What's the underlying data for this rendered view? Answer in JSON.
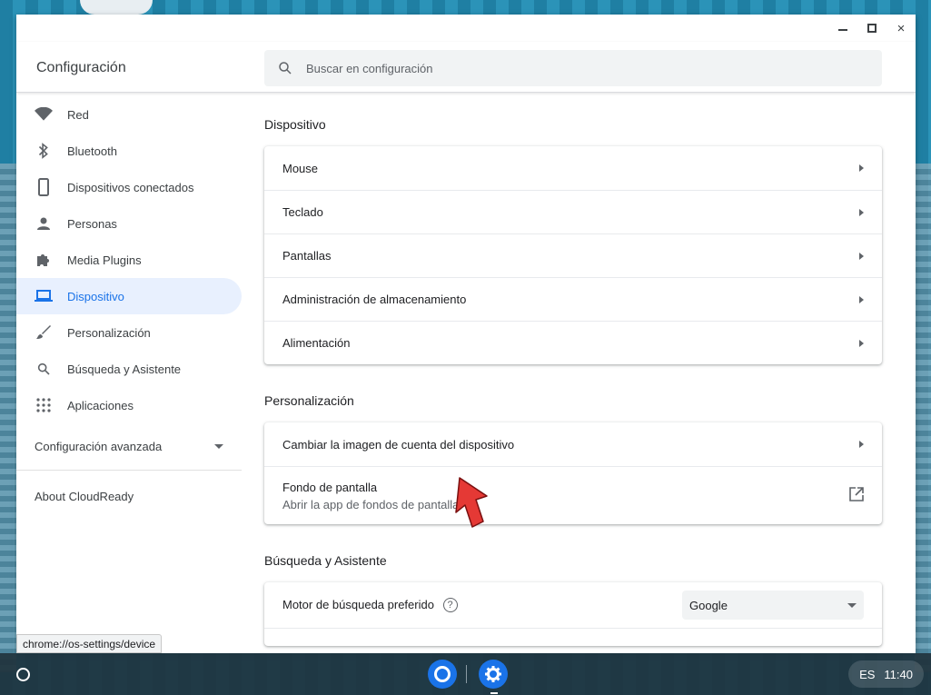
{
  "window": {
    "title": "Configuración",
    "controls": {
      "minimize": "minimize-icon",
      "maximize": "maximize-icon",
      "close": "×"
    }
  },
  "search": {
    "placeholder": "Buscar en configuración",
    "icon": "search-icon"
  },
  "sidebar": {
    "items": [
      {
        "label": "Red",
        "icon": "wifi-icon"
      },
      {
        "label": "Bluetooth",
        "icon": "bluetooth-icon"
      },
      {
        "label": "Dispositivos conectados",
        "icon": "phone-icon"
      },
      {
        "label": "Personas",
        "icon": "person-icon"
      },
      {
        "label": "Media Plugins",
        "icon": "puzzle-icon"
      },
      {
        "label": "Dispositivo",
        "icon": "laptop-icon",
        "active": true
      },
      {
        "label": "Personalización",
        "icon": "brush-icon"
      },
      {
        "label": "Búsqueda y Asistente",
        "icon": "search-icon"
      },
      {
        "label": "Aplicaciones",
        "icon": "apps-grid-icon"
      }
    ],
    "advanced": "Configuración avanzada",
    "about": "About CloudReady"
  },
  "main": {
    "device": {
      "title": "Dispositivo",
      "rows": [
        "Mouse",
        "Teclado",
        "Pantallas",
        "Administración de almacenamiento",
        "Alimentación"
      ]
    },
    "personalization": {
      "title": "Personalización",
      "account_image": "Cambiar la imagen de cuenta del dispositivo",
      "wallpaper": "Fondo de pantalla",
      "wallpaper_sub": "Abrir la app de fondos de pantalla"
    },
    "search_assistant": {
      "title": "Búsqueda y Asistente",
      "engine_label": "Motor de búsqueda preferido",
      "engine_value": "Google",
      "help": "?"
    }
  },
  "status_url": "chrome://os-settings/device",
  "shelf": {
    "tray_lang": "ES",
    "tray_time": "11:40"
  },
  "colors": {
    "accent": "#1a73e8",
    "active_bg": "#e8f0fe",
    "annotation": "#e53935"
  }
}
